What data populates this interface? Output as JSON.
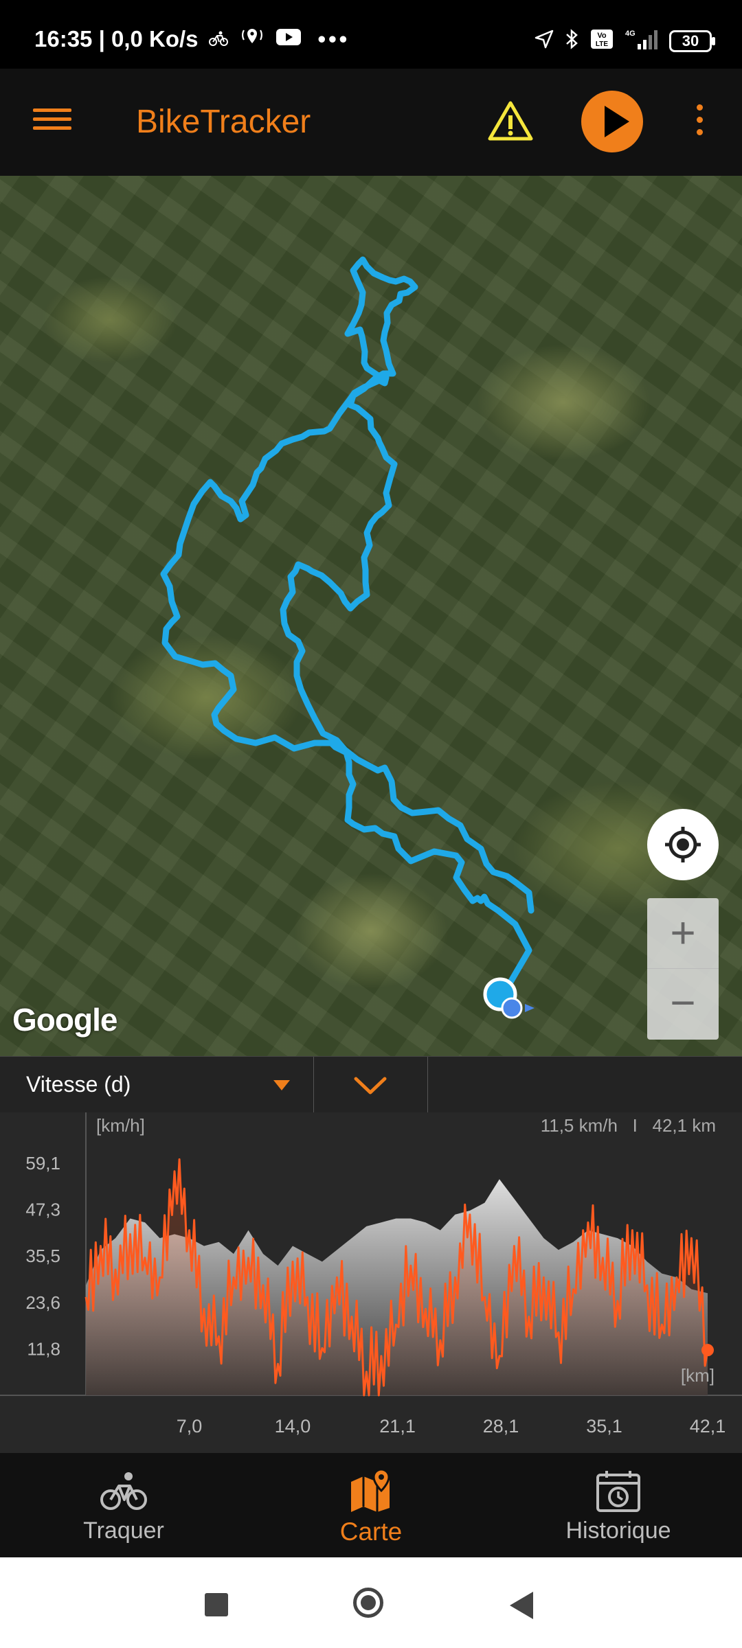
{
  "status_bar": {
    "time_speed": "16:35 | 0,0 Ko/s",
    "overflow": "•••",
    "battery": "30",
    "network": "4G"
  },
  "app_bar": {
    "title": "BikeTracker",
    "colors": {
      "accent": "#f07f1b",
      "background": "#111111",
      "warning": "#f5e63c"
    }
  },
  "map": {
    "provider_logo": "Google",
    "route_color": "#1fa9e8",
    "zoom_in": "+",
    "zoom_out": "−"
  },
  "graph_selector": {
    "selected_metric": "Vitesse (d)"
  },
  "chart_data": {
    "type": "area",
    "unit_label": "[km/h]",
    "x_unit_label": "[km]",
    "readout": "11,5 km/h   I   42,1 km",
    "y_ticks": [
      "59,1",
      "47,3",
      "35,5",
      "23,6",
      "11,8"
    ],
    "x_ticks": [
      "7,0",
      "14,0",
      "21,1",
      "28,1",
      "35,1",
      "42,1"
    ],
    "ylim": [
      0,
      65.0
    ],
    "xlim": [
      0,
      42.1
    ],
    "series": [
      {
        "kind": "elevation_profile",
        "color": "#d0d0d0",
        "x": [
          0,
          1,
          2,
          3,
          4,
          5,
          6,
          7,
          8,
          9,
          10,
          11,
          12,
          13,
          14,
          15,
          16,
          17,
          18,
          19,
          20,
          21,
          22,
          23,
          24,
          25,
          26,
          27,
          28,
          29,
          30,
          31,
          32,
          33,
          34,
          35,
          36,
          37,
          38,
          39,
          40,
          41,
          42.1
        ],
        "values": [
          28,
          37,
          40,
          45,
          44,
          40,
          41,
          40,
          38,
          39,
          36,
          42,
          36,
          33,
          38,
          36,
          34,
          37,
          40,
          43,
          44,
          45,
          45,
          44,
          42,
          46,
          47,
          49,
          55,
          50,
          45,
          40,
          37,
          39,
          42,
          41,
          40,
          38,
          34,
          31,
          30,
          27,
          26
        ]
      },
      {
        "kind": "speed",
        "color": "#ff5a1f",
        "x": [
          0,
          1,
          2,
          3,
          4,
          5,
          6,
          7,
          8,
          9,
          10,
          11,
          12,
          13,
          14,
          15,
          16,
          17,
          18,
          19,
          20,
          21,
          22,
          23,
          24,
          25,
          26,
          27,
          28,
          29,
          30,
          31,
          32,
          33,
          34,
          35,
          36,
          37,
          38,
          39,
          40,
          41,
          42.1
        ],
        "values": [
          25,
          38,
          32,
          41,
          35,
          30,
          57,
          42,
          22,
          15,
          30,
          35,
          28,
          8,
          34,
          25,
          12,
          30,
          20,
          6,
          10,
          18,
          33,
          22,
          14,
          30,
          46,
          25,
          10,
          38,
          20,
          30,
          16,
          27,
          44,
          35,
          24,
          42,
          28,
          18,
          30,
          40,
          11.5
        ]
      }
    ]
  },
  "bottom_nav": {
    "items": [
      {
        "label": "Traquer",
        "icon": "cyclist-icon",
        "active": false
      },
      {
        "label": "Carte",
        "icon": "map-pin-icon",
        "active": true
      },
      {
        "label": "Historique",
        "icon": "history-calendar-icon",
        "active": false
      }
    ]
  }
}
